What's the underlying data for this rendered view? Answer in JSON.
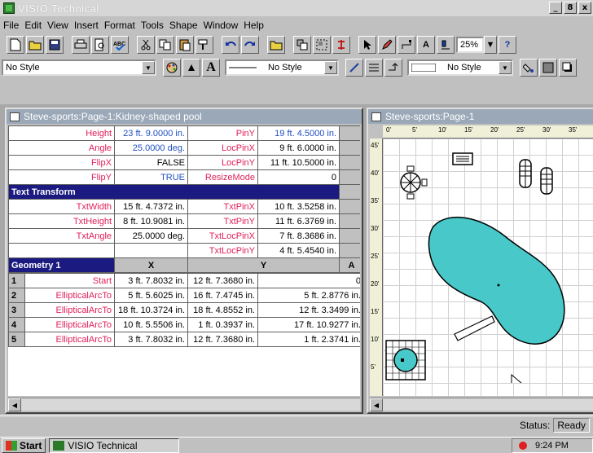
{
  "app": {
    "title": "VISIO Technical"
  },
  "window_controls": {
    "minimize": "_",
    "restore": "8",
    "close": "x"
  },
  "menu": [
    {
      "label": "File"
    },
    {
      "label": "Edit"
    },
    {
      "label": "View"
    },
    {
      "label": "Insert"
    },
    {
      "label": "Format"
    },
    {
      "label": "Tools"
    },
    {
      "label": "Shape"
    },
    {
      "label": "Window"
    },
    {
      "label": "Help"
    }
  ],
  "toolbar": {
    "zoom": "25%",
    "text_tool": "A",
    "help_tool": "?"
  },
  "formatbar": {
    "style": "No Style",
    "text_style": "A",
    "line_style": "No Style",
    "fill_style": "No Style"
  },
  "shapesheet": {
    "title": "Steve-sports:Page-1:Kidney-shaped pool",
    "transform_rows": [
      {
        "l1": "Height",
        "v1": "23 ft. 9.0000 in.",
        "l2": "PinY",
        "v2": "19 ft. 4.5000 in."
      },
      {
        "l1": "Angle",
        "v1": "25.0000 deg.",
        "l2": "LocPinX",
        "v2": "9 ft. 6.0000 in."
      },
      {
        "l1": "FlipX",
        "v1": "FALSE",
        "l2": "LocPinY",
        "v2": "11 ft. 10.5000 in."
      },
      {
        "l1": "FlipY",
        "v1": "TRUE",
        "l2": "ResizeMode",
        "v2": "0"
      }
    ],
    "text_transform": {
      "header": "Text Transform",
      "rows": [
        {
          "l1": "TxtWidth",
          "v1": "15 ft. 4.7372 in.",
          "l2": "TxtPinX",
          "v2": "10 ft. 3.5258 in."
        },
        {
          "l1": "TxtHeight",
          "v1": "8 ft. 10.9081 in.",
          "l2": "TxtPinY",
          "v2": "11 ft. 6.3769 in."
        },
        {
          "l1": "TxtAngle",
          "v1": "25.0000 deg.",
          "l2": "TxtLocPinX",
          "v2": "7 ft. 8.3686 in."
        },
        {
          "l1": "",
          "v1": "",
          "l2": "TxtLocPinY",
          "v2": "4 ft. 5.4540 in."
        }
      ]
    },
    "geometry": {
      "header": "Geometry 1",
      "columns": [
        "X",
        "Y",
        "A"
      ],
      "rows": [
        {
          "n": "1",
          "name": "Start",
          "x": "3 ft. 7.8032 in.",
          "y": "12 ft. 7.3680 in.",
          "a": "0"
        },
        {
          "n": "2",
          "name": "EllipticalArcTo",
          "x": "5 ft. 5.6025 in.",
          "y": "16 ft. 7.4745 in.",
          "a": "5 ft. 2.8776 in."
        },
        {
          "n": "3",
          "name": "EllipticalArcTo",
          "x": "18 ft. 10.3724 in.",
          "y": "18 ft. 4.8552 in.",
          "a": "12 ft. 3.3499 in."
        },
        {
          "n": "4",
          "name": "EllipticalArcTo",
          "x": "10 ft. 5.5506 in.",
          "y": "1 ft. 0.3937 in.",
          "a": "17 ft. 10.9277 in."
        },
        {
          "n": "5",
          "name": "EllipticalArcTo",
          "x": "3 ft. 7.8032 in.",
          "y": "12 ft. 7.3680 in.",
          "a": "1 ft. 2.3741 in."
        }
      ]
    }
  },
  "drawing": {
    "title": "Steve-sports:Page-1",
    "ruler_h": [
      "0'",
      "5'",
      "10'",
      "15'",
      "20'",
      "25'",
      "30'",
      "35'"
    ],
    "ruler_v": [
      "45'",
      "40'",
      "35'",
      "30'",
      "25'",
      "20'",
      "15'",
      "10'",
      "5'"
    ]
  },
  "status": {
    "label": "Status:",
    "value": "Ready"
  },
  "taskbar": {
    "start": "Start",
    "task": "VISIO Technical",
    "clock": "9:24 PM"
  },
  "colors": {
    "pool_fill": "#48c8c8",
    "header_blue": "#1a1a80",
    "label_pink": "#e0205a",
    "value_blue": "#2050c0"
  }
}
